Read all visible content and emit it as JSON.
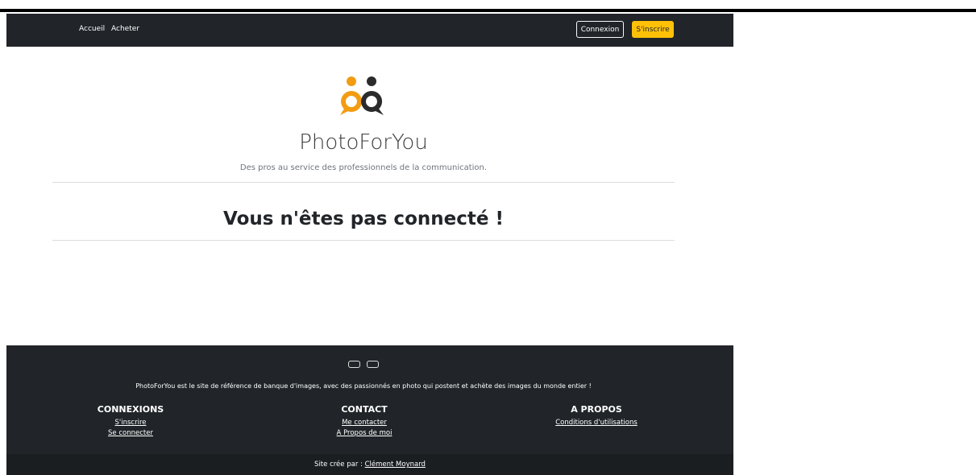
{
  "nav": {
    "links": [
      "Accueil",
      "Acheter"
    ],
    "login_label": "Connexion",
    "signup_label": "S'inscrire"
  },
  "header": {
    "brand": "PhotoForYou",
    "tagline": "Des pros au service des professionnels de la communication."
  },
  "main": {
    "notice": "Vous n'êtes pas connecté !"
  },
  "footer": {
    "social_icons": [
      "social-icon-1",
      "social-icon-2"
    ],
    "description": "PhotoForYou est le site de référence de banque d'images, avec des passionnés en photo qui postent et achète des images du monde entier !",
    "columns": [
      {
        "title": "CONNEXIONS",
        "links": [
          "S'inscrire",
          "Se connecter"
        ]
      },
      {
        "title": "CONTACT",
        "links": [
          "Me contacter",
          "A Propos de moi"
        ]
      },
      {
        "title": "A PROPOS",
        "links": [
          "Conditions d'utilisations"
        ]
      }
    ],
    "credit_prefix": "Site crée par : ",
    "credit_name": "Clément Moynard"
  },
  "colors": {
    "navbar_bg": "#212529",
    "accent": "#ffc107",
    "logo_orange": "#f39c12",
    "logo_dark": "#2b2b2b"
  }
}
